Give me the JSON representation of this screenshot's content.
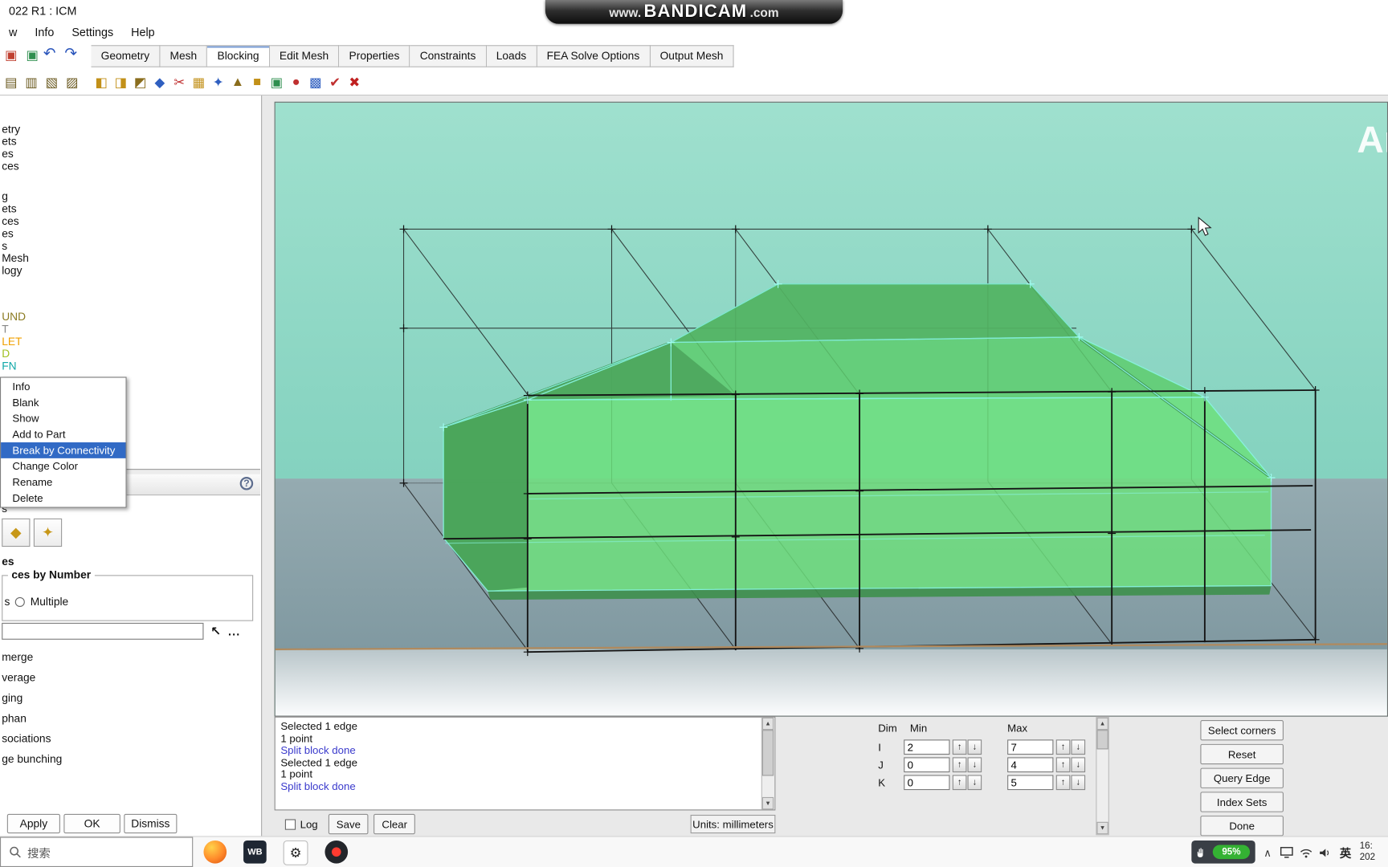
{
  "colors": {
    "accent_blue": "#316ac5",
    "sky_top": "#9fe0ce",
    "sky_bottom": "#84d2bf",
    "ground_top": "#95abb1",
    "ground_bottom": "#8099a1",
    "car_light_green": "#6de07c",
    "car_dark_green": "#47a056",
    "cyan_edge": "#88f5e2",
    "message_blue": "#3a3acc",
    "battery_green": "#34b233",
    "brown_ground_line": "#b08a5e"
  },
  "glyphs": {
    "spin_up": "↑",
    "spin_down": "↓",
    "scroll_up": "▲",
    "scroll_down": "▼",
    "help": "?",
    "dots": "...",
    "pick": "↖",
    "undo": "↶",
    "redo": "↷",
    "chevron_up": "∧"
  },
  "title_bar": {
    "title": "022 R1 : ICM"
  },
  "bandicam": {
    "www": "www.",
    "brand": "BANDICAM",
    "com": ".com"
  },
  "menu": {
    "items": [
      "w",
      "Info",
      "Settings",
      "Help"
    ]
  },
  "tabs": {
    "items": [
      {
        "label": "Geometry",
        "name": "geometry"
      },
      {
        "label": "Mesh",
        "name": "mesh"
      },
      {
        "label": "Blocking",
        "name": "blocking",
        "active": true
      },
      {
        "label": "Edit Mesh",
        "name": "edit-mesh"
      },
      {
        "label": "Properties",
        "name": "properties"
      },
      {
        "label": "Constraints",
        "name": "constraints"
      },
      {
        "label": "Loads",
        "name": "loads"
      },
      {
        "label": "FEA Solve Options",
        "name": "fea-solve-options"
      },
      {
        "label": "Output Mesh",
        "name": "output-mesh"
      }
    ]
  },
  "toolbar": {
    "window_icons": [
      {
        "name": "app-1",
        "glyph": "▣",
        "color": "#c04030"
      },
      {
        "name": "app-2",
        "glyph": "▣",
        "color": "#2f8f4f"
      }
    ],
    "left_icons": [
      {
        "name": "view-tool-1",
        "glyph": "▤",
        "color": "#6b5a20"
      },
      {
        "name": "view-tool-2",
        "glyph": "▥",
        "color": "#6b5a20"
      },
      {
        "name": "view-tool-3",
        "glyph": "▧",
        "color": "#6b5a20"
      },
      {
        "name": "view-tool-4",
        "glyph": "▨",
        "color": "#6b5a20"
      }
    ],
    "icons": [
      {
        "name": "create-block",
        "glyph": "◧",
        "color": "#c29018"
      },
      {
        "name": "split-block",
        "glyph": "◨",
        "color": "#c29018"
      },
      {
        "name": "ogrid-block",
        "glyph": "◩",
        "color": "#8a6d1d"
      },
      {
        "name": "merge-vertices",
        "glyph": "◆",
        "color": "#2f5fc0"
      },
      {
        "name": "edit-edge",
        "glyph": "✂",
        "color": "#c03030"
      },
      {
        "name": "associate",
        "glyph": "▦",
        "color": "#c29018"
      },
      {
        "name": "move-vertex",
        "glyph": "✦",
        "color": "#2f5fc0"
      },
      {
        "name": "transform-blocks",
        "glyph": "▲",
        "color": "#8a6d1d"
      },
      {
        "name": "edit-block",
        "glyph": "■",
        "color": "#c29018"
      },
      {
        "name": "pre-mesh-params",
        "glyph": "▣",
        "color": "#2f8f4f"
      },
      {
        "name": "pre-mesh-quality",
        "glyph": "●",
        "color": "#c03030"
      },
      {
        "name": "block-checks",
        "glyph": "▩",
        "color": "#2f5fc0"
      },
      {
        "name": "pre-mesh-smooth",
        "glyph": "✔",
        "color": "#c03030"
      },
      {
        "name": "delete-block",
        "glyph": "✖",
        "color": "#c02020"
      }
    ]
  },
  "tree": {
    "items": [
      {
        "label": "etry",
        "color": "#111111"
      },
      {
        "label": "ets",
        "color": "#111111"
      },
      {
        "label": "es",
        "color": "#111111"
      },
      {
        "label": "ces",
        "color": "#111111"
      },
      {
        "label": "g",
        "color": "#111111",
        "gap": 20
      },
      {
        "label": "ets",
        "color": "#111111"
      },
      {
        "label": "ces",
        "color": "#111111"
      },
      {
        "label": "es",
        "color": "#111111"
      },
      {
        "label": "s",
        "color": "#111111"
      },
      {
        "label": "Mesh",
        "color": "#111111"
      },
      {
        "label": "logy",
        "color": "#111111"
      },
      {
        "label": "UND",
        "color": "#8a7a20",
        "gap": 38
      },
      {
        "label": "T",
        "color": "#888888"
      },
      {
        "label": "LET",
        "color": "#f0a000"
      },
      {
        "label": "D",
        "color": "#a0c020"
      },
      {
        "label": "FN",
        "color": "#10a8a8"
      }
    ]
  },
  "context_menu": {
    "items": [
      {
        "label": "Info",
        "name": "info"
      },
      {
        "label": "Blank",
        "name": "blank"
      },
      {
        "label": "Show",
        "name": "show"
      },
      {
        "label": "Add to Part",
        "name": "add-to-part"
      },
      {
        "label": "Break by Connectivity",
        "name": "break-by-connectivity",
        "highlighted": true
      },
      {
        "label": "Change Color",
        "name": "change-color"
      },
      {
        "label": "Rename",
        "name": "rename"
      },
      {
        "label": "Delete",
        "name": "delete"
      }
    ]
  },
  "tools_panel": {
    "section_label": "s",
    "chips": [
      {
        "name": "edge-param-tool",
        "glyph": "◆"
      },
      {
        "name": "move-vertex-tool",
        "glyph": "✦"
      }
    ],
    "group_label": "es",
    "fieldset_legend": "ces by Number",
    "radio_prefix": "s",
    "radio_label": "Multiple",
    "input_value": "",
    "options": [
      "merge",
      "verage",
      "ging",
      "phan",
      "sociations",
      "ge bunching"
    ],
    "apply": "Apply",
    "ok": "OK",
    "dismiss": "Dismiss"
  },
  "viewport": {
    "watermark": "Ar"
  },
  "messages": {
    "lines": [
      {
        "text": "Selected 1 edge",
        "color": "#111111"
      },
      {
        "text": "1 point",
        "color": "#111111"
      },
      {
        "text": "Split block done",
        "color": "#3a3acc"
      },
      {
        "text": "Selected 1 edge",
        "color": "#111111"
      },
      {
        "text": "1 point",
        "color": "#111111"
      },
      {
        "text": "Split block done",
        "color": "#3a3acc"
      }
    ],
    "log": "Log",
    "save": "Save",
    "clear": "Clear",
    "units": "Units: millimeters"
  },
  "index_panel": {
    "dim": "Dim",
    "min": "Min",
    "max": "Max",
    "rows": [
      {
        "dim": "I",
        "min": "2",
        "max": "7"
      },
      {
        "dim": "J",
        "min": "0",
        "max": "4"
      },
      {
        "dim": "K",
        "min": "0",
        "max": "5"
      }
    ],
    "buttons": [
      {
        "label": "Select corners",
        "name": "select-corners"
      },
      {
        "label": "Reset",
        "name": "reset"
      },
      {
        "label": "Query Edge",
        "name": "query-edge"
      },
      {
        "label": "Index Sets",
        "name": "index-sets"
      },
      {
        "label": "Done",
        "name": "done"
      }
    ]
  },
  "taskbar": {
    "search_placeholder": "搜索",
    "apps": [
      {
        "name": "firefox"
      },
      {
        "name": "workbench",
        "label": "WB"
      },
      {
        "name": "icem",
        "label": "⚙"
      },
      {
        "name": "bandicam"
      }
    ],
    "tray": {
      "battery": "95%",
      "ime": "英",
      "time": "16:",
      "date": "202"
    }
  }
}
